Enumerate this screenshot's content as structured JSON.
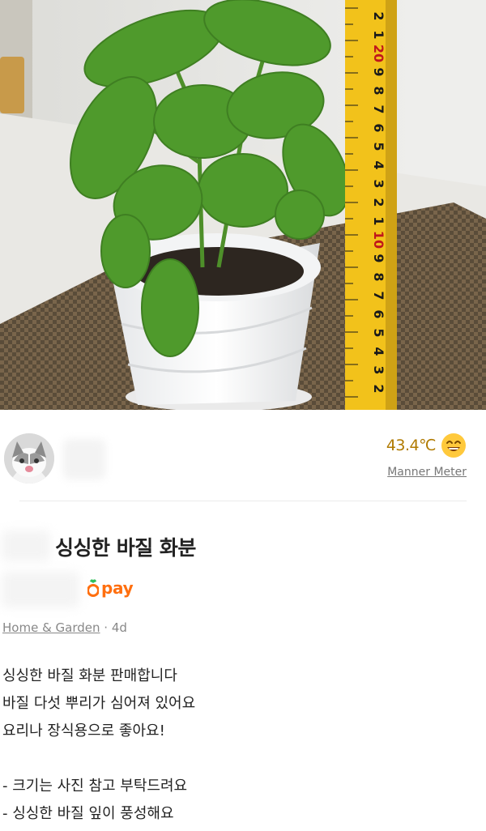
{
  "photo": {
    "ruler_numbers": [
      "2",
      "1",
      "20",
      "9",
      "8",
      "7",
      "6",
      "5",
      "4",
      "3",
      "2",
      "1",
      "10",
      "9",
      "8",
      "7",
      "6",
      "5",
      "4",
      "3",
      "2"
    ]
  },
  "seller": {
    "manner_temperature": "43.4℃",
    "manner_label": "Manner Meter"
  },
  "listing": {
    "title": "싱싱한 바질 화분",
    "pay_label": "pay",
    "category": "Home & Garden",
    "separator": " · ",
    "age": "4d",
    "description": [
      "싱싱한 바질 화분 판매합니다",
      "바질 다섯 뿌리가 심어져 있어요",
      "요리나 장식용으로 좋아요!",
      "",
      "- 크기는 사진 참고 부탁드려요",
      "- 싱싱한 바질 잎이 풍성해요"
    ]
  },
  "colors": {
    "accent_orange": "#ff6f0f",
    "temperature": "#b07a00",
    "leaf": "#4f9a2c"
  },
  "icons": [
    "cat-avatar-icon",
    "smile-face-icon",
    "carrot-pay-icon"
  ]
}
